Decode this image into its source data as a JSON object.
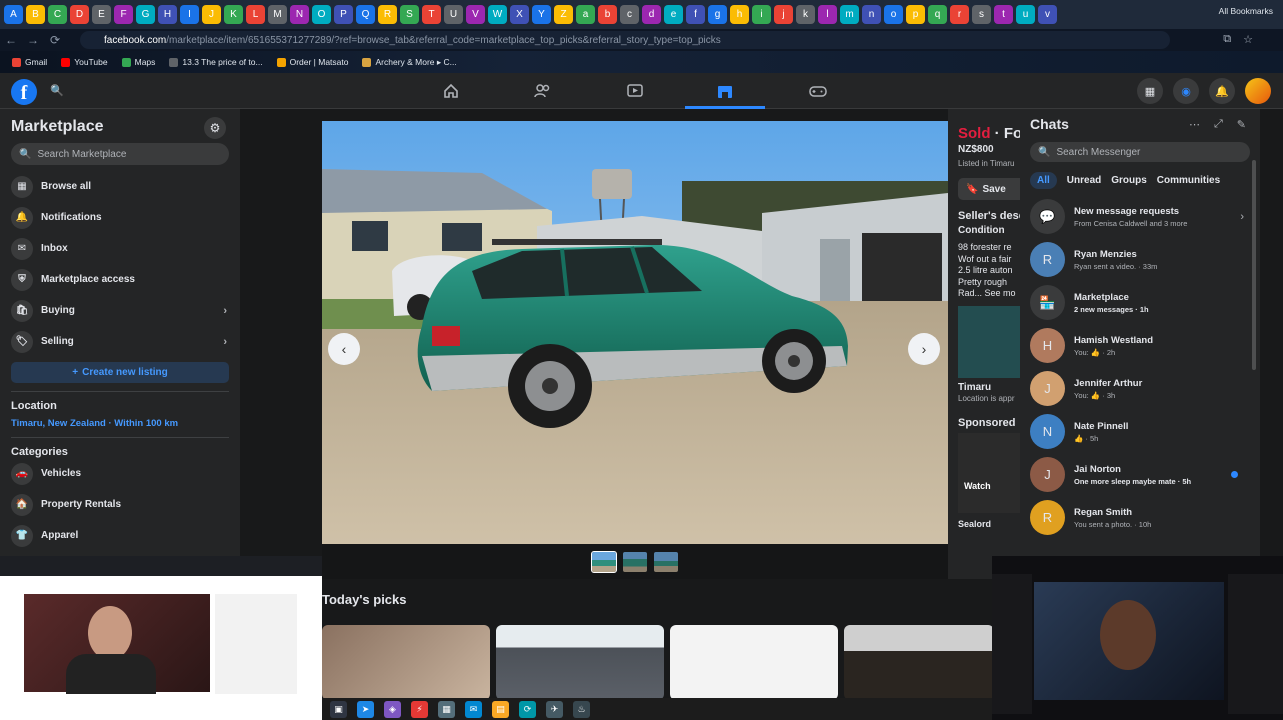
{
  "browser": {
    "tab_icons": [
      "A",
      "B",
      "C",
      "D",
      "E",
      "F",
      "G",
      "H",
      "I",
      "J",
      "K",
      "L",
      "M",
      "N",
      "O",
      "P",
      "Q",
      "R",
      "S",
      "T",
      "U",
      "V",
      "W",
      "X",
      "Y",
      "Z",
      "a",
      "b",
      "c",
      "d",
      "e",
      "f",
      "g",
      "h",
      "i",
      "j",
      "k",
      "l",
      "m",
      "n",
      "o",
      "p",
      "q",
      "r",
      "s",
      "t",
      "u",
      "v"
    ],
    "url_host": "facebook.com",
    "url_path": "/marketplace/item/651655371277289/?ref=browse_tab&referral_code=marketplace_top_picks&referral_story_type=top_picks",
    "bookmarks": [
      {
        "label": "Gmail",
        "color": "#ea4335"
      },
      {
        "label": "YouTube",
        "color": "#ff0000"
      },
      {
        "label": "Maps",
        "color": "#34a853"
      },
      {
        "label": "13.3 The price of to...",
        "color": "#5f6368"
      },
      {
        "label": "Order | Matsato",
        "color": "#f4a300"
      },
      {
        "label": "Archery & More ▸ C...",
        "color": "#d9a441"
      }
    ],
    "all_bookmarks": "All Bookmarks"
  },
  "fb": {
    "logo": "f",
    "nav_tabs": [
      "home-icon",
      "friends-icon",
      "watch-icon",
      "marketplace-icon",
      "gaming-icon"
    ]
  },
  "sidebar": {
    "title": "Marketplace",
    "search_placeholder": "Search Marketplace",
    "items": [
      {
        "label": "Browse all",
        "icon": "▦"
      },
      {
        "label": "Notifications",
        "icon": "🔔"
      },
      {
        "label": "Inbox",
        "icon": "✉"
      },
      {
        "label": "Marketplace access",
        "icon": "⛨"
      },
      {
        "label": "Buying",
        "icon": "🛍"
      },
      {
        "label": "Selling",
        "icon": "🏷"
      }
    ],
    "create_listing": "Create new listing",
    "location_heading": "Location",
    "location_value": "Timaru, New Zealand · Within 100 km",
    "categories_heading": "Categories",
    "categories": [
      {
        "label": "Vehicles",
        "icon": "🚗"
      },
      {
        "label": "Property Rentals",
        "icon": "🏠"
      },
      {
        "label": "Apparel",
        "icon": "👕"
      }
    ]
  },
  "listing": {
    "sold": "Sold",
    "title_fragment": "· Fo",
    "price": "NZ$800",
    "listed": "Listed in Timaru",
    "save": "Save",
    "desc_heading": "Seller's desc",
    "condition": "Condition",
    "desc_lines": [
      "98 forester re",
      "Wof out a fair",
      "2.5 litre auton",
      "Pretty rough",
      "Rad... See mo"
    ],
    "location_name": "Timaru",
    "location_note": "Location is appr",
    "sponsored": "Sponsored",
    "watch": "Watch",
    "seller_fragment": "Sealord"
  },
  "chats": {
    "title": "Chats",
    "search_placeholder": "Search Messenger",
    "filters": [
      "All",
      "Unread",
      "Groups",
      "Communities"
    ],
    "items": [
      {
        "name": "New message requests",
        "sub": "From Cenisa Caldwell and 3 more",
        "avatar": "💬",
        "color": "#3a3b3c",
        "unread": false
      },
      {
        "name": "Ryan Menzies",
        "sub": "Ryan sent a video. · 33m",
        "avatar": "R",
        "color": "#4a7fb5",
        "unread": false
      },
      {
        "name": "Marketplace",
        "sub": "2 new messages · 1h",
        "avatar": "🏪",
        "color": "#3a3b3c",
        "unread": true
      },
      {
        "name": "Hamish Westland",
        "sub": "You: 👍 · 2h",
        "avatar": "H",
        "color": "#b07a5e",
        "unread": false
      },
      {
        "name": "Jennifer Arthur",
        "sub": "You: 👍 · 3h",
        "avatar": "J",
        "color": "#d1a070",
        "unread": false
      },
      {
        "name": "Nate Pinnell",
        "sub": "👍 · 5h",
        "avatar": "N",
        "color": "#3d7fc2",
        "unread": false
      },
      {
        "name": "Jai Norton",
        "sub": "One more sleep maybe mate · 5h",
        "avatar": "J",
        "color": "#8c5a46",
        "unread": true
      },
      {
        "name": "Regan Smith",
        "sub": "You sent a photo. · 10h",
        "avatar": "R",
        "color": "#e0a020",
        "unread": false
      }
    ]
  },
  "picks": {
    "title": "Today's picks"
  },
  "taskbar": {
    "icons": [
      "▣",
      "➤",
      "◈",
      "⚡",
      "▦",
      "✉",
      "▤",
      "⟳",
      "✈",
      "♨"
    ]
  }
}
